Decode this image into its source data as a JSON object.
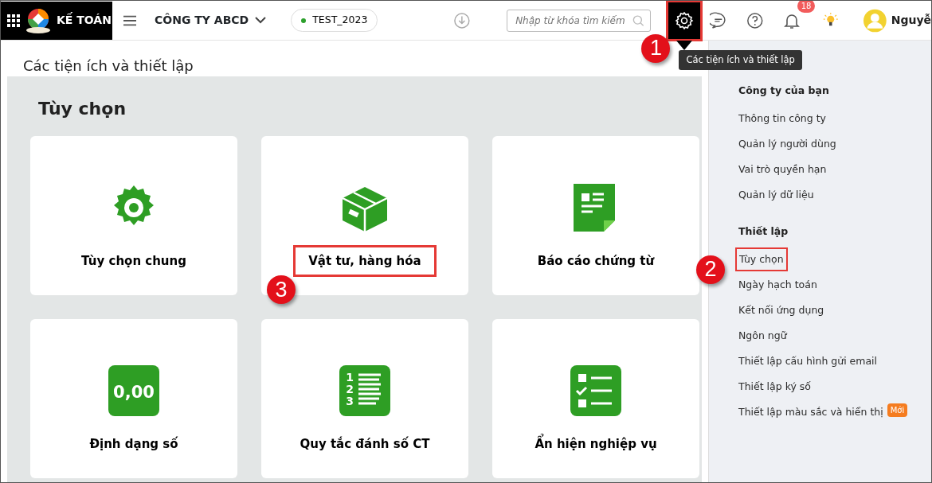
{
  "topbar": {
    "app_name": "KẾ TOÁN",
    "company": "CÔNG TY ABCD",
    "database": {
      "label": "TEST_2023",
      "color": "#2ca02c"
    },
    "search": {
      "placeholder": "Nhập từ khóa tìm kiếm"
    },
    "settings": {
      "highlighted": true,
      "callout": "1",
      "tooltip": "Các tiện ích và thiết lập"
    },
    "notification_count": "18",
    "user_name": "Nguyễ"
  },
  "page_title": "Các tiện ích và thiết lập",
  "panel": {
    "title": "Tùy chọn",
    "tiles": [
      {
        "label": "Tùy chọn chung",
        "kind": "gear",
        "highlighted": false
      },
      {
        "label": "Vật tư, hàng hóa",
        "kind": "box",
        "highlighted": true,
        "callout": "3"
      },
      {
        "label": "Báo cáo chứng từ",
        "kind": "document",
        "highlighted": false
      },
      {
        "label": "Định dạng số",
        "kind": "number",
        "icon_text": "0,00",
        "highlighted": false
      },
      {
        "label": "Quy tắc đánh số CT",
        "kind": "list",
        "icon_digits": [
          "1",
          "2",
          "3"
        ],
        "highlighted": false
      },
      {
        "label": "Ẩn hiện nghiệp vụ",
        "kind": "checklist",
        "highlighted": false
      }
    ]
  },
  "sidebar": {
    "sections": [
      {
        "title": "Công ty của bạn",
        "items": [
          {
            "label": "Thông tin công ty",
            "highlighted": false
          },
          {
            "label": "Quản lý người dùng",
            "highlighted": false
          },
          {
            "label": "Vai trò quyền hạn",
            "highlighted": false
          },
          {
            "label": "Quản lý dữ liệu",
            "highlighted": false
          }
        ]
      },
      {
        "title": "Thiết lập",
        "items": [
          {
            "label": "Tùy chọn",
            "highlighted": true,
            "callout": "2"
          },
          {
            "label": "Ngày hạch toán",
            "highlighted": false
          },
          {
            "label": "Kết nối ứng dụng",
            "highlighted": false
          },
          {
            "label": "Ngôn ngữ",
            "highlighted": false
          },
          {
            "label": "Thiết lập cấu hình gửi email",
            "highlighted": false
          },
          {
            "label": "Thiết lập ký số",
            "highlighted": false
          },
          {
            "label": "Thiết lập màu sắc và hiển thị",
            "highlighted": false,
            "badge": "Mới"
          }
        ]
      }
    ]
  }
}
